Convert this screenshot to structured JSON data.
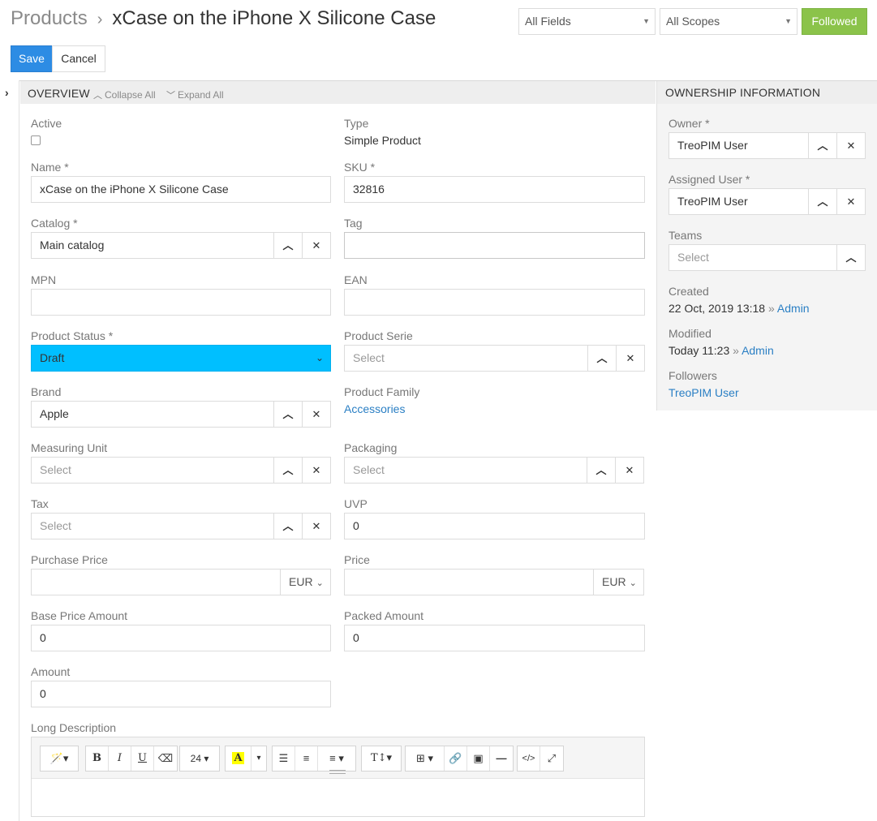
{
  "header": {
    "breadcrumb_root": "Products",
    "breadcrumb_sep": "›",
    "title": "xCase on the iPhone X Silicone Case",
    "fields_select": "All Fields",
    "scopes_select": "All Scopes",
    "followed_label": "Followed",
    "save_label": "Save",
    "cancel_label": "Cancel"
  },
  "overview": {
    "title": "OVERVIEW",
    "collapse_all": "Collapse All",
    "expand_all": "Expand All",
    "fields": {
      "active": {
        "label": "Active",
        "checked": false
      },
      "type": {
        "label": "Type",
        "value": "Simple Product"
      },
      "name": {
        "label": "Name *",
        "value": "xCase on the iPhone X Silicone Case"
      },
      "sku": {
        "label": "SKU *",
        "value": "32816"
      },
      "catalog": {
        "label": "Catalog *",
        "value": "Main catalog"
      },
      "tag": {
        "label": "Tag",
        "value": ""
      },
      "mpn": {
        "label": "MPN",
        "value": ""
      },
      "ean": {
        "label": "EAN",
        "value": ""
      },
      "product_status": {
        "label": "Product Status *",
        "value": "Draft"
      },
      "product_serie": {
        "label": "Product Serie",
        "placeholder": "Select"
      },
      "brand": {
        "label": "Brand",
        "value": "Apple"
      },
      "product_family": {
        "label": "Product Family",
        "value": "Accessories"
      },
      "measuring_unit": {
        "label": "Measuring Unit",
        "placeholder": "Select"
      },
      "packaging": {
        "label": "Packaging",
        "placeholder": "Select"
      },
      "tax": {
        "label": "Tax",
        "placeholder": "Select"
      },
      "uvp": {
        "label": "UVP",
        "value": "0"
      },
      "purchase_price": {
        "label": "Purchase Price",
        "value": "",
        "currency": "EUR"
      },
      "price": {
        "label": "Price",
        "value": "",
        "currency": "EUR"
      },
      "base_price_amount": {
        "label": "Base Price Amount",
        "value": "0"
      },
      "packed_amount": {
        "label": "Packed Amount",
        "value": "0"
      },
      "amount": {
        "label": "Amount",
        "value": "0"
      },
      "long_description": {
        "label": "Long Description",
        "value": ""
      }
    },
    "editor": {
      "font_size": "24",
      "bold": "B",
      "italic": "I",
      "underline": "U",
      "text_style": "T",
      "code_view": "</>",
      "highlight_color": "#ffff00"
    }
  },
  "ownership": {
    "title": "OWNERSHIP INFORMATION",
    "owner": {
      "label": "Owner *",
      "value": "TreoPIM User"
    },
    "assigned_user": {
      "label": "Assigned User *",
      "value": "TreoPIM User"
    },
    "teams": {
      "label": "Teams",
      "placeholder": "Select"
    },
    "created": {
      "label": "Created",
      "value": "22 Oct, 2019 13:18",
      "sep": "»",
      "by": "Admin"
    },
    "modified": {
      "label": "Modified",
      "value": "Today 11:23",
      "sep": "»",
      "by": "Admin"
    },
    "followers": {
      "label": "Followers",
      "value": "TreoPIM User"
    }
  },
  "colors": {
    "primary": "#2d8ce4",
    "followed": "#8bc34a",
    "status_draft": "#00bfff",
    "link": "#2a7fc4"
  }
}
